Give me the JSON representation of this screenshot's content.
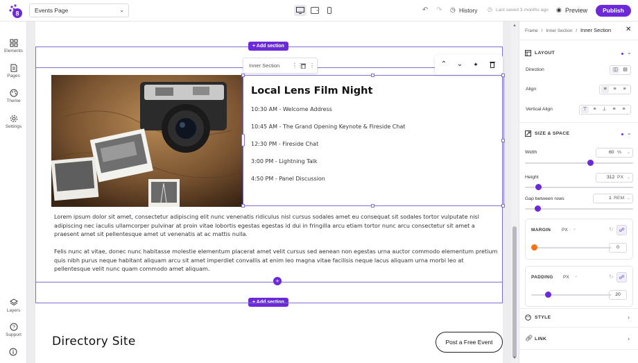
{
  "topbar": {
    "page_select": "Events Page",
    "history_label": "History",
    "last_saved": "Last saved 3 months ago",
    "preview_label": "Preview",
    "publish_label": "Publish"
  },
  "leftrail": {
    "items": [
      {
        "label": "Elements",
        "icon": "grid-icon"
      },
      {
        "label": "Pages",
        "icon": "page-icon"
      },
      {
        "label": "Theme",
        "icon": "palette-icon"
      },
      {
        "label": "Settings",
        "icon": "gear-icon"
      },
      {
        "label": "Layers",
        "icon": "layers-icon"
      },
      {
        "label": "Support",
        "icon": "help-icon"
      }
    ]
  },
  "canvas": {
    "add_section": "+ Add section",
    "toolbar_label": "Inner Section",
    "event_title": "Local Lens Film Night",
    "schedule": [
      "10:30 AM - Welcome Address",
      "10:45 AM - The Grand Opening Keynote & Fireside Chat",
      "12:30 PM - Fireside Chat",
      "3:00 PM - Lightning Talk",
      "4:50 PM - Panel Discussion"
    ],
    "paragraph1": "Lorem ipsum dolor sit amet, consectetur adipiscing elit nunc venenatis ridiculus nisl cursus sodales amet eu consequat sit sodales tortor vulputate nisl adipiscing nec iaculis ullamcorper pulvinar at proin vitae lobortis egestas egestas id dui in fringilla arcu etiam tortor nunc arcu consectetur sit amet a praesent amet sit pellentesque amet ut venenatis at ac mattis nulla.",
    "paragraph2": "Felis nunc at vitae, donec nunc habitasse molestie elementum placerat amet velit cursus sed aenean non egestas urna auctor commodo elementum pretium quis nibh purus neque habitant aliquam arcu sit amet imperdiet convallis at enim leo magna vitae facilisis neque lacus aliquam urna morbi leo at pellentesque velit nunc quam commodo amet aliquam.",
    "directory_title": "Directory Site",
    "post_event_label": "Post a Free Event"
  },
  "rpanel": {
    "breadcrumb": [
      "Frame",
      "Inner Section",
      "Inner Section"
    ],
    "layout_head": "LAYOUT",
    "direction_label": "Direction",
    "align_label": "Align",
    "valign_label": "Vertical Align",
    "size_head": "SIZE & SPACE",
    "width_label": "Width",
    "width_value": "60",
    "width_unit": "%",
    "width_fraction": 0.6,
    "height_label": "Height",
    "height_value": "312",
    "height_unit": "PX",
    "gap_label": "Gap between rows",
    "gap_value": "1",
    "gap_unit": "REM",
    "margin_head": "MARGIN",
    "margin_unit": "PX",
    "margin_value": "0",
    "padding_head": "PADDING",
    "padding_unit": "PX",
    "padding_value": "20",
    "style_head": "STYLE",
    "link_head": "LINK",
    "accent": "#6d28d9",
    "margin_knob_color": "#f97316"
  }
}
